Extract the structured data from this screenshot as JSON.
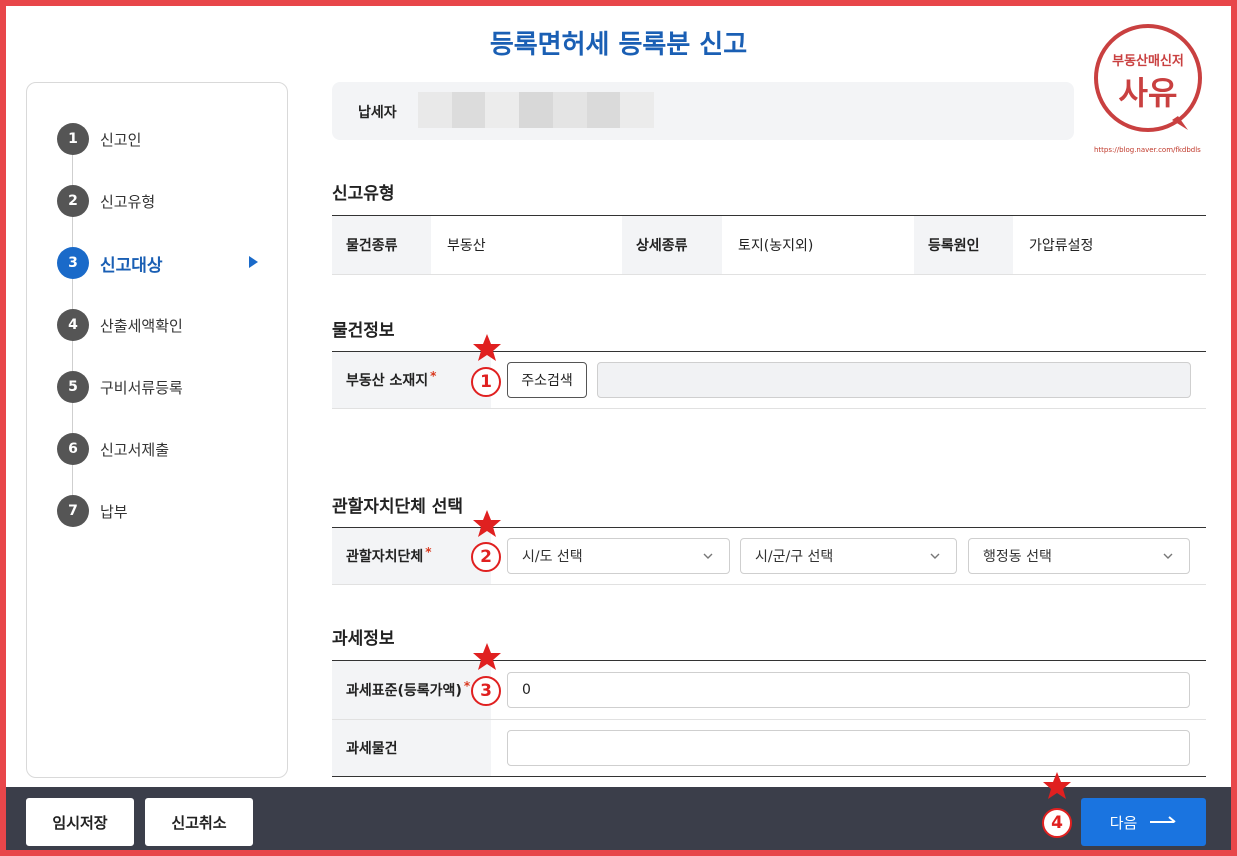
{
  "page_title": "등록면허세 등록분 신고",
  "badge": {
    "line1": "부동산매신저",
    "line2": "사유",
    "url": "https://blog.naver.com/fkdbdls"
  },
  "sidebar": {
    "steps": [
      {
        "num": "1",
        "label": "신고인"
      },
      {
        "num": "2",
        "label": "신고유형"
      },
      {
        "num": "3",
        "label": "신고대상"
      },
      {
        "num": "4",
        "label": "산출세액확인"
      },
      {
        "num": "5",
        "label": "구비서류등록"
      },
      {
        "num": "6",
        "label": "신고서제출"
      },
      {
        "num": "7",
        "label": "납부"
      }
    ],
    "active_step": 3
  },
  "payer": {
    "label": "납세자"
  },
  "report_type": {
    "heading": "신고유형",
    "item_kind_label": "물건종류",
    "item_kind_value": "부동산",
    "detail_kind_label": "상세종류",
    "detail_kind_value": "토지(농지외)",
    "reason_label": "등록원인",
    "reason_value": "가압류설정"
  },
  "property_info": {
    "heading": "물건정보",
    "location_label": "부동산 소재지",
    "required_mark": "*",
    "address_search_button": "주소검색",
    "address_value": ""
  },
  "jurisdiction": {
    "heading": "관할자치단체 선택",
    "label": "관할자치단체",
    "required_mark": "*",
    "province_select": "시/도 선택",
    "city_select": "시/군/구 선택",
    "dong_select": "행정동 선택"
  },
  "tax_info": {
    "heading": "과세정보",
    "base_label": "과세표준(등록가액)",
    "required_mark": "*",
    "base_value": "0",
    "object_label": "과세물건",
    "object_value": ""
  },
  "annotations": {
    "n1": "1",
    "n2": "2",
    "n3": "3",
    "n4": "4",
    "color": "#e02020"
  },
  "footer": {
    "temp_save": "임시저장",
    "cancel": "신고취소",
    "next": "다음"
  },
  "colors": {
    "accent": "#1a5fb4",
    "next_button": "#1a74e0",
    "footer_bg": "#3b3e4a",
    "frame": "#e8464a"
  }
}
